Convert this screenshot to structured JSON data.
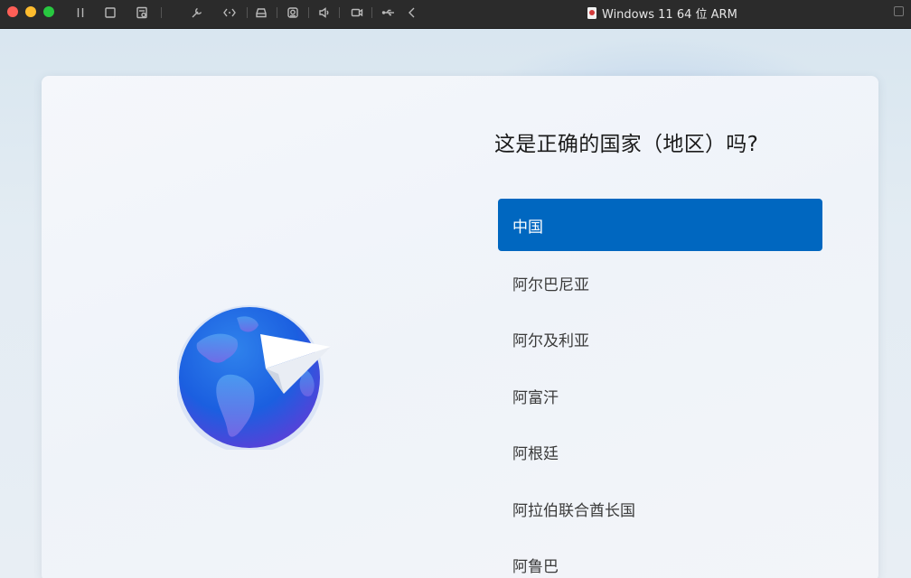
{
  "window": {
    "title": "Windows 11 64 位 ARM"
  },
  "toolbar": {
    "icons": [
      "pause-icon",
      "stop-icon",
      "snapshot-icon",
      "wrench-icon",
      "code-brackets-icon",
      "drive-icon",
      "camera-icon",
      "speaker-icon",
      "video-icon",
      "usb-icon",
      "chevron-left-icon"
    ]
  },
  "setup": {
    "heading": "这是正确的国家（地区）吗?",
    "countries": [
      "中国",
      "阿尔巴尼亚",
      "阿尔及利亚",
      "阿富汗",
      "阿根廷",
      "阿拉伯联合酋长国",
      "阿鲁巴"
    ],
    "selected_index": 0
  },
  "colors": {
    "accent": "#0067c0",
    "titlebar": "#2b2b2b",
    "traffic_close": "#ff5f57",
    "traffic_min": "#febc2e",
    "traffic_max": "#28c840"
  }
}
